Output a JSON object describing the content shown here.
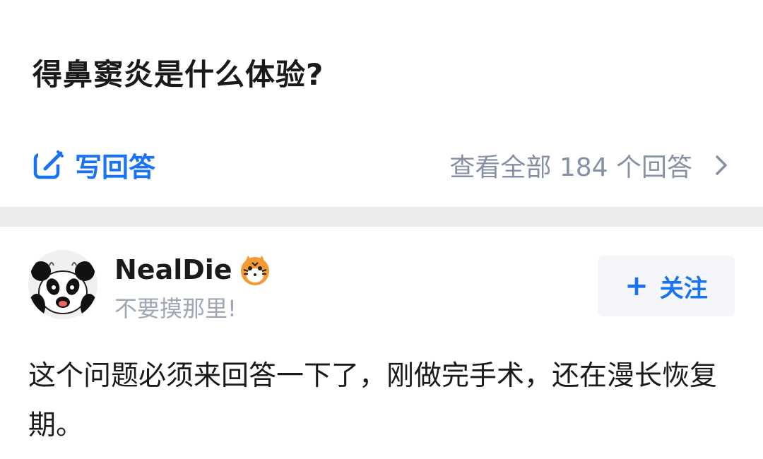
{
  "question": {
    "title": "得鼻窦炎是什么体验?"
  },
  "actions": {
    "write_answer_label": "写回答",
    "view_all_label": "查看全部 184 个回答",
    "write_icon": "edit-icon",
    "view_all_icon": "chevron-right-icon"
  },
  "answer": {
    "author": {
      "name": "NealDie",
      "bio": "不要摸那里!",
      "avatar_icon": "panda-avatar",
      "badge_icon": "tiger-badge-icon"
    },
    "follow_button_label": "关注",
    "content": "这个问题必须来回答一下了，刚做完手术，还在漫长恢复期。"
  },
  "colors": {
    "accent": "#1772f6",
    "muted_text": "#8590a6",
    "divider": "#ebecee",
    "follow_bg": "#f4f6f9"
  }
}
